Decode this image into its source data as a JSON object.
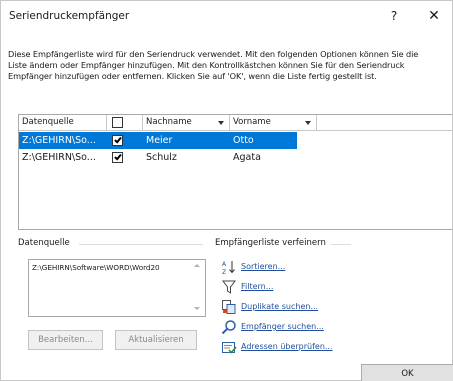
{
  "window": {
    "title": "Seriendruckempfänger",
    "help_label": "?",
    "close_label": "✕"
  },
  "description": {
    "lines": [
      "Diese Empfängerliste wird für den Seriendruck verwendet. Mit den folgenden Optionen können Sie die",
      "Liste ändern oder Empfänger hinzufügen. Mit den Kontrollkästchen können Sie für den Seriendruck",
      "Empfänger hinzufügen oder entfernen. Klicken Sie auf 'OK', wenn die Liste fertig gestellt ist."
    ]
  },
  "table": {
    "columns": {
      "source": "Datenquelle",
      "last_name": "Nachname",
      "first_name": "Vorname"
    },
    "header_checked": false,
    "rows": [
      {
        "source": "Z:\\GEHIRN\\So...",
        "checked": true,
        "last_name": "Meier",
        "first_name": "Otto",
        "selected": true
      },
      {
        "source": "Z:\\GEHIRN\\So...",
        "checked": true,
        "last_name": "Schulz",
        "first_name": "Agata",
        "selected": false
      }
    ]
  },
  "datasource": {
    "label": "Datenquelle",
    "path": "Z:\\GEHIRN\\Software\\WORD\\Word20",
    "edit_label": "Bearbeiten...",
    "refresh_label": "Aktualisieren"
  },
  "refine": {
    "label": "Empfängerliste verfeinern",
    "links": {
      "sort": "Sortieren...",
      "filter": "Filtern...",
      "duplicates": "Duplikate suchen...",
      "find": "Empfänger suchen...",
      "validate": "Adressen überprüfen..."
    }
  },
  "footer": {
    "ok_label": "OK"
  },
  "colors": {
    "selection": "#0078d7",
    "link": "#1f4e9e"
  }
}
